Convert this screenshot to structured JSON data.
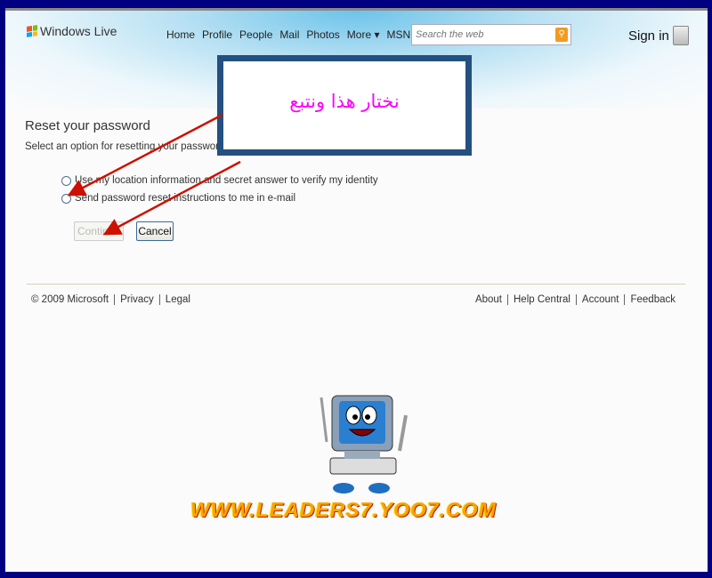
{
  "header": {
    "logo": "Windows Live",
    "nav": [
      "Home",
      "Profile",
      "People",
      "Mail",
      "Photos",
      "More ▾",
      "MSN ▾"
    ],
    "search_placeholder": "Search the web",
    "signin": "Sign in"
  },
  "callout": {
    "text": "نختار هذا ونتبع"
  },
  "form": {
    "title": "Reset your password",
    "subtitle": "Select an option for resetting your password:",
    "options": [
      "Use my location information and secret answer to verify my identity",
      "Send password reset instructions to me in e-mail"
    ],
    "continue": "Continue",
    "cancel": "Cancel"
  },
  "footer": {
    "left": [
      "© 2009 Microsoft",
      "Privacy",
      "Legal"
    ],
    "right": [
      "About",
      "Help Central",
      "Account",
      "Feedback"
    ]
  },
  "watermark": {
    "url": "WWW.LEADERS7.YOO7.COM"
  },
  "colors": {
    "frame": "#000080",
    "callout_border": "#245080",
    "callout_text": "#ff00ff",
    "arrow": "#cc1100",
    "search_button": "#f39a1e"
  }
}
